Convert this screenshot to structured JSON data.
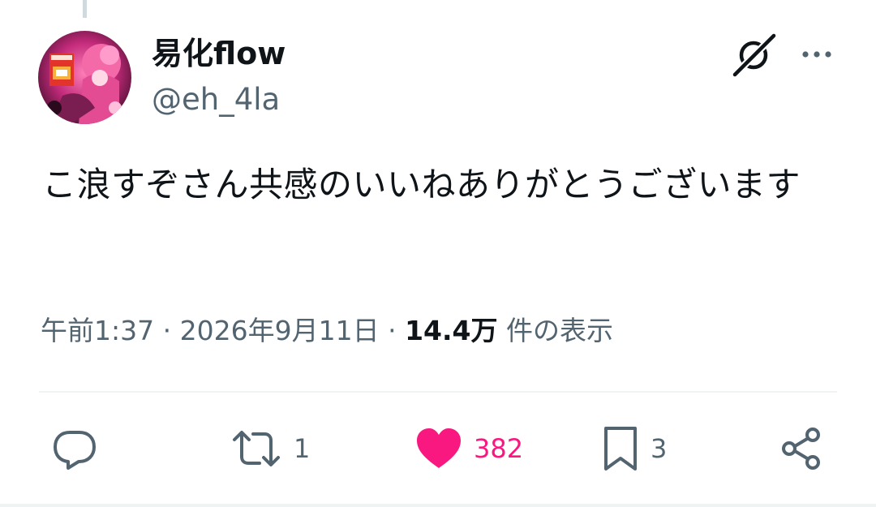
{
  "author": {
    "display_name": "易化flow",
    "handle": "@eh_4la",
    "avatar_icon": "avatar-anime-character"
  },
  "header_icons": {
    "grok": "grok-icon",
    "more": "more-icon"
  },
  "tweet": {
    "text": "こ浪すぞさん共感のいいねありがとうございます",
    "time": "午前1:37",
    "separator": "·",
    "date": "2026年9月11日",
    "views_count": "14.4万",
    "views_label": "件の表示"
  },
  "actions": {
    "reply": {
      "icon": "reply-icon",
      "count": ""
    },
    "repost": {
      "icon": "repost-icon",
      "count": "1"
    },
    "like": {
      "icon": "heart-icon",
      "count": "382",
      "color": "#f91880"
    },
    "bookmark": {
      "icon": "bookmark-icon",
      "count": "3"
    },
    "share": {
      "icon": "share-icon",
      "count": ""
    }
  },
  "colors": {
    "text_primary": "#0f1419",
    "text_secondary": "#536471",
    "like_pink": "#f91880",
    "divider": "#eff3f4"
  }
}
